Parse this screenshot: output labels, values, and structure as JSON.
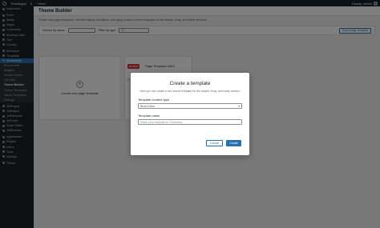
{
  "adminbar": {
    "site": "Travelogue",
    "notif_count": "0",
    "new_label": "+ New",
    "greeting": "Howdy, admin"
  },
  "sidebar": {
    "items": [
      {
        "label": "Dashboard",
        "type": "item"
      },
      {
        "label": "",
        "type": "sep"
      },
      {
        "label": "Posts",
        "type": "item"
      },
      {
        "label": "Media",
        "type": "item"
      },
      {
        "label": "Pages",
        "type": "item"
      },
      {
        "label": "Comments",
        "type": "item"
      },
      {
        "label": "Booking Order",
        "type": "item"
      },
      {
        "label": "Tour",
        "type": "item"
      },
      {
        "label": "Country",
        "type": "item"
      },
      {
        "label": "",
        "type": "sep"
      },
      {
        "label": "Elementor",
        "type": "item"
      },
      {
        "label": "Templates",
        "type": "item"
      },
      {
        "label": "ElementsKit",
        "type": "item"
      },
      {
        "label": "ElementsKit",
        "type": "sub"
      },
      {
        "label": "Widgets",
        "type": "sub"
      },
      {
        "label": "Header Footer",
        "type": "sub"
      },
      {
        "label": "Get Help",
        "type": "sub"
      },
      {
        "label": "Theme Builder",
        "type": "sub",
        "current": true
      },
      {
        "label": "Theme Templates",
        "type": "sub"
      },
      {
        "label": "Saved Templates",
        "type": "sub"
      },
      {
        "label": "Settings",
        "type": "sub"
      },
      {
        "label": "",
        "type": "sep"
      },
      {
        "label": "JetPlugins",
        "type": "item"
      },
      {
        "label": "JetEngine",
        "type": "item"
      },
      {
        "label": "JetElements",
        "type": "item"
      },
      {
        "label": "JetTricks",
        "type": "item"
      },
      {
        "label": "Smart Filters",
        "type": "item"
      },
      {
        "label": "JetReviews",
        "type": "item"
      },
      {
        "label": "",
        "type": "sep"
      },
      {
        "label": "Appearance",
        "type": "item"
      },
      {
        "label": "Plugins",
        "type": "item"
      },
      {
        "label": "Users",
        "type": "item"
      },
      {
        "label": "Tools",
        "type": "item"
      },
      {
        "label": "Settings",
        "type": "item"
      },
      {
        "label": "",
        "type": "sep"
      },
      {
        "label": "Theme",
        "type": "item"
      }
    ]
  },
  "page": {
    "title": "Theme Builder",
    "description": "Create new page templates, set their display conditions, and apply custom theme templates to the header, body, and footer sections.",
    "search_label": "Search by name",
    "search_placeholder": "",
    "filter_label": "Filter by type",
    "filter_value": "All",
    "import_button": "Import page template",
    "create_card_label": "Create new page template",
    "template_badge": "Archive",
    "template_title": "Page Template #362"
  },
  "modal": {
    "title": "Create a template",
    "description": "Here you can create a new theme template for the header, body, and footer section.",
    "content_type_label": "Template content type",
    "content_type_value": "Block Editor",
    "name_label": "Template name",
    "name_placeholder": "Name your template for Gutenberg",
    "cancel": "Cancel",
    "create": "Create"
  },
  "colors": {
    "accent": "#2271b1",
    "sidebar_bg": "#1d2327",
    "badge": "#d63638"
  }
}
